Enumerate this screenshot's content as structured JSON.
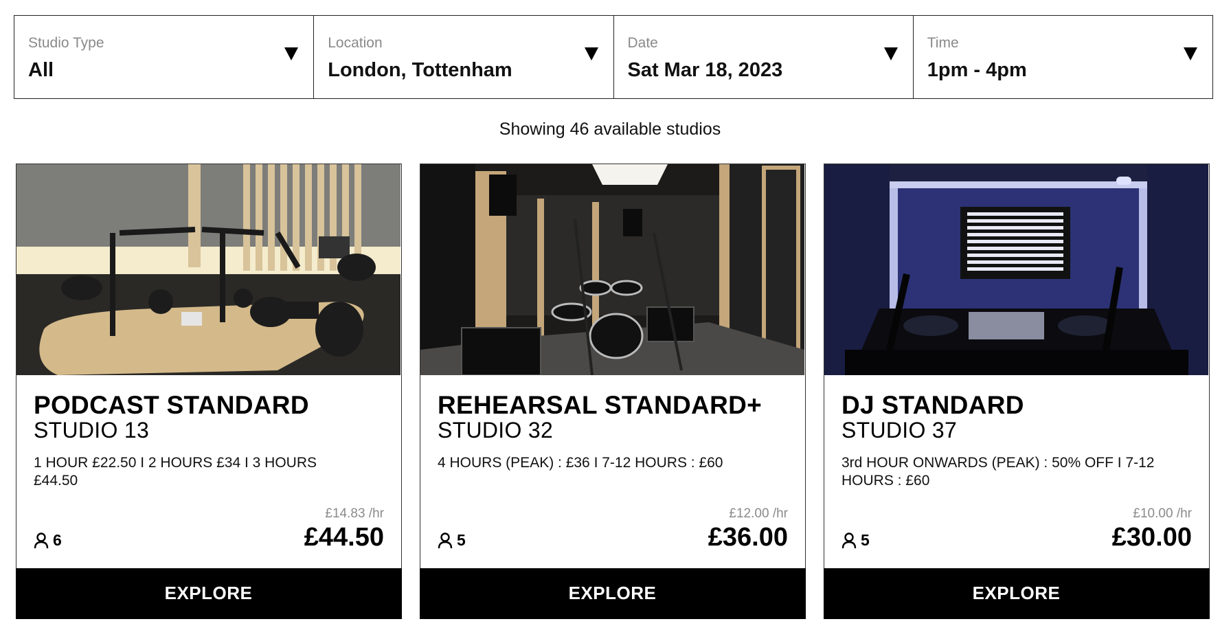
{
  "filters": [
    {
      "label": "Studio Type",
      "value": "All"
    },
    {
      "label": "Location",
      "value": "London, Tottenham"
    },
    {
      "label": "Date",
      "value": "Sat Mar 18, 2023"
    },
    {
      "label": "Time",
      "value": "1pm - 4pm"
    }
  ],
  "results_text": "Showing 46 available studios",
  "cards": [
    {
      "title": "PODCAST STANDARD",
      "subtitle": "STUDIO 13",
      "description": "1 HOUR £22.50 I 2 HOURS £34 I 3 HOURS £44.50",
      "capacity": "6",
      "rate": "£14.83 /hr",
      "price": "£44.50",
      "button": "EXPLORE"
    },
    {
      "title": "REHEARSAL STANDARD+",
      "subtitle": "STUDIO 32",
      "description": "4 HOURS (PEAK) : £36 I 7-12 HOURS : £60",
      "capacity": "5",
      "rate": "£12.00 /hr",
      "price": "£36.00",
      "button": "EXPLORE"
    },
    {
      "title": "DJ STANDARD",
      "subtitle": "STUDIO 37",
      "description": "3rd HOUR ONWARDS (PEAK) : 50% OFF I 7-12 HOURS : £60",
      "capacity": "5",
      "rate": "£10.00 /hr",
      "price": "£30.00",
      "button": "EXPLORE"
    }
  ],
  "icons": {
    "caret": "caret-down-icon",
    "capacity": "person-icon"
  }
}
